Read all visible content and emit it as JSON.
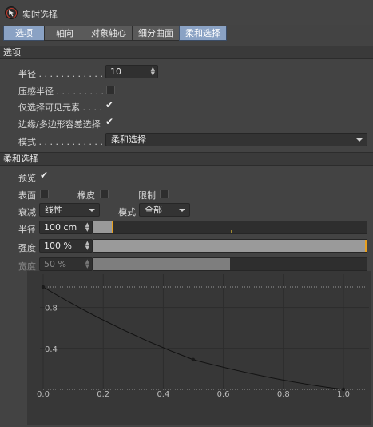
{
  "header": {
    "title": "实时选择",
    "icon": "selection-arrow-icon"
  },
  "tabs": [
    {
      "label": "选项",
      "active": true
    },
    {
      "label": "轴向",
      "active": false
    },
    {
      "label": "对象轴心",
      "active": false
    },
    {
      "label": "细分曲面",
      "active": false
    },
    {
      "label": "柔和选择",
      "active": true
    }
  ],
  "options": {
    "section_title": "选项",
    "radius_label": "半径 . . . . . . . . . . . . .",
    "radius_value": "10",
    "pressure_label": "压感半径 . . . . . . . . .",
    "pressure_checked": false,
    "visible_only_label": "仅选择可见元素 . . . .",
    "visible_only_checked": true,
    "tolerance_label": "边缘/多边形容差选择",
    "tolerance_checked": true,
    "mode_label": "模式 . . . . . . . . . . . . .",
    "mode_value": "柔和选择"
  },
  "soft": {
    "section_title": "柔和选择",
    "preview_label": "预览",
    "preview_checked": true,
    "surface_label": "表面",
    "surface_checked": false,
    "rubber_label": "橡皮",
    "rubber_checked": false,
    "restrict_label": "限制",
    "restrict_checked": false,
    "falloff_label": "衰减",
    "falloff_value": "线性",
    "mode_label": "模式",
    "mode_value": "全部",
    "radius_label": "半径",
    "radius_value": "100 cm",
    "radius_fraction": 0.07,
    "strength_label": "强度",
    "strength_value": "100 %",
    "strength_fraction": 1.0,
    "width_label": "宽度",
    "width_value": "50 %",
    "width_fraction": 0.5
  },
  "chart_data": {
    "type": "line",
    "x": [
      0.0,
      0.5,
      1.0
    ],
    "y": [
      1.0,
      0.29,
      0.0
    ],
    "xlim": [
      0.0,
      1.0
    ],
    "ylim": [
      0.0,
      1.0
    ],
    "x_ticks": [
      "0.0",
      "0.2",
      "0.4",
      "0.6",
      "0.8",
      "1.0"
    ],
    "y_ticks": [
      "0.4",
      "0.8"
    ],
    "grid": true
  }
}
